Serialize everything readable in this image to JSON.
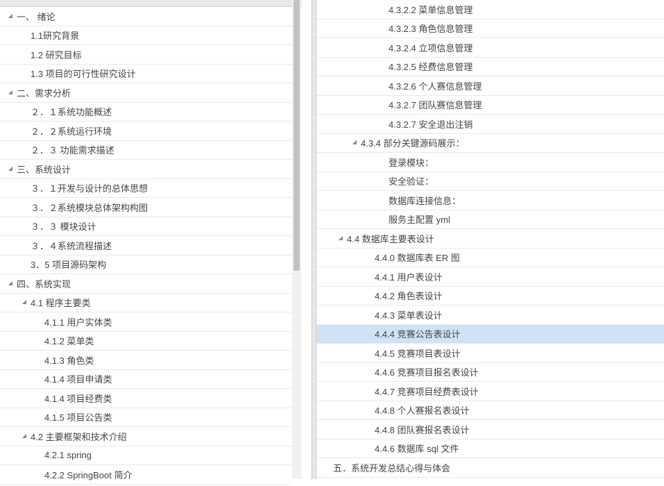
{
  "leftTree": [
    {
      "indent": 0,
      "arrow": "expanded",
      "label": "一、 绪论"
    },
    {
      "indent": 1,
      "arrow": "none",
      "label": "1.1研究背景"
    },
    {
      "indent": 1,
      "arrow": "none",
      "label": "1.2 研究目标"
    },
    {
      "indent": 1,
      "arrow": "none",
      "label": "1.3 项目的可行性研究设计"
    },
    {
      "indent": 0,
      "arrow": "expanded",
      "label": "二、需求分析"
    },
    {
      "indent": 1,
      "arrow": "none",
      "label": "２．１系统功能概述"
    },
    {
      "indent": 1,
      "arrow": "none",
      "label": "２．２系统运行环境"
    },
    {
      "indent": 1,
      "arrow": "none",
      "label": "２．３ 功能需求描述"
    },
    {
      "indent": 0,
      "arrow": "expanded",
      "label": "三、系统设计"
    },
    {
      "indent": 1,
      "arrow": "none",
      "label": "３．１开发与设计的总体思想"
    },
    {
      "indent": 1,
      "arrow": "none",
      "label": "３．２系统模块总体架构构图"
    },
    {
      "indent": 1,
      "arrow": "none",
      "label": "３．３ 模块设计"
    },
    {
      "indent": 1,
      "arrow": "none",
      "label": "３．４系统流程描述"
    },
    {
      "indent": 1,
      "arrow": "none",
      "label": "3．5 项目源码架构"
    },
    {
      "indent": 0,
      "arrow": "expanded",
      "label": "四、系统实现"
    },
    {
      "indent": 1,
      "arrow": "expanded",
      "label": "4.1  程序主要类"
    },
    {
      "indent": 2,
      "arrow": "none",
      "label": "4.1.1 用户实体类"
    },
    {
      "indent": 2,
      "arrow": "none",
      "label": "4.1.2 菜单类"
    },
    {
      "indent": 2,
      "arrow": "none",
      "label": "4.1.3 角色类"
    },
    {
      "indent": 2,
      "arrow": "none",
      "label": "4.1.4 项目申请类"
    },
    {
      "indent": 2,
      "arrow": "none",
      "label": "4.1.4 项目经费类"
    },
    {
      "indent": 2,
      "arrow": "none",
      "label": "4.1.5 项目公告类"
    },
    {
      "indent": 1,
      "arrow": "expanded",
      "label": "4.2  主要框架和技术介绍"
    },
    {
      "indent": 2,
      "arrow": "none",
      "label": "4.2.1 spring"
    },
    {
      "indent": 2,
      "arrow": "none",
      "label": "4.2.2 SpringBoot 简介"
    }
  ],
  "rightTree": [
    {
      "indent": 4,
      "arrow": "none",
      "label": "4.3.2.2  菜单信息管理"
    },
    {
      "indent": 4,
      "arrow": "none",
      "label": "4.3.2.3  角色信息管理"
    },
    {
      "indent": 4,
      "arrow": "none",
      "label": "4.3.2.4  立项信息管理"
    },
    {
      "indent": 4,
      "arrow": "none",
      "label": "4.3.2.5  经费信息管理"
    },
    {
      "indent": 4,
      "arrow": "none",
      "label": "4.3.2.6  个人赛信息管理"
    },
    {
      "indent": 4,
      "arrow": "none",
      "label": "4.3.2.7  团队赛信息管理"
    },
    {
      "indent": 4,
      "arrow": "none",
      "label": "4.3.2.7  安全退出注销"
    },
    {
      "indent": 2,
      "arrow": "expanded",
      "label": "4.3.4 部分关键源码展示："
    },
    {
      "indent": 4,
      "arrow": "none",
      "label": "登录模块："
    },
    {
      "indent": 4,
      "arrow": "none",
      "label": "安全验证："
    },
    {
      "indent": 4,
      "arrow": "none",
      "label": "数据库连接信息："
    },
    {
      "indent": 4,
      "arrow": "none",
      "label": "服务主配置 yml"
    },
    {
      "indent": 1,
      "arrow": "expanded",
      "label": "4.4 数据库主要表设计"
    },
    {
      "indent": 3,
      "arrow": "none",
      "label": "4.4.0 数据库表 ER 图"
    },
    {
      "indent": 3,
      "arrow": "none",
      "label": "4.4.1 用户表设计"
    },
    {
      "indent": 3,
      "arrow": "none",
      "label": "4.4.2 角色表设计"
    },
    {
      "indent": 3,
      "arrow": "none",
      "label": "4.4.3 菜单表设计"
    },
    {
      "indent": 3,
      "arrow": "none",
      "label": "4.4.4 竞赛公告表设计",
      "selected": true
    },
    {
      "indent": 3,
      "arrow": "none",
      "label": "4.4.5 竞赛项目表设计"
    },
    {
      "indent": 3,
      "arrow": "none",
      "label": "4.4.6 竞赛项目报名表设计"
    },
    {
      "indent": 3,
      "arrow": "none",
      "label": "4.4.7 竞赛项目经费表设计"
    },
    {
      "indent": 3,
      "arrow": "none",
      "label": "4.4.8 个人赛报名表设计"
    },
    {
      "indent": 3,
      "arrow": "none",
      "label": "4.4.8 团队赛报名表设计"
    },
    {
      "indent": 3,
      "arrow": "none",
      "label": "4.4.6 数据库 sql 文件"
    },
    {
      "indent": 0,
      "arrow": "none",
      "label": "五．系统开发总结心得与体会"
    }
  ],
  "indentBase": 8,
  "indentStep": 20
}
